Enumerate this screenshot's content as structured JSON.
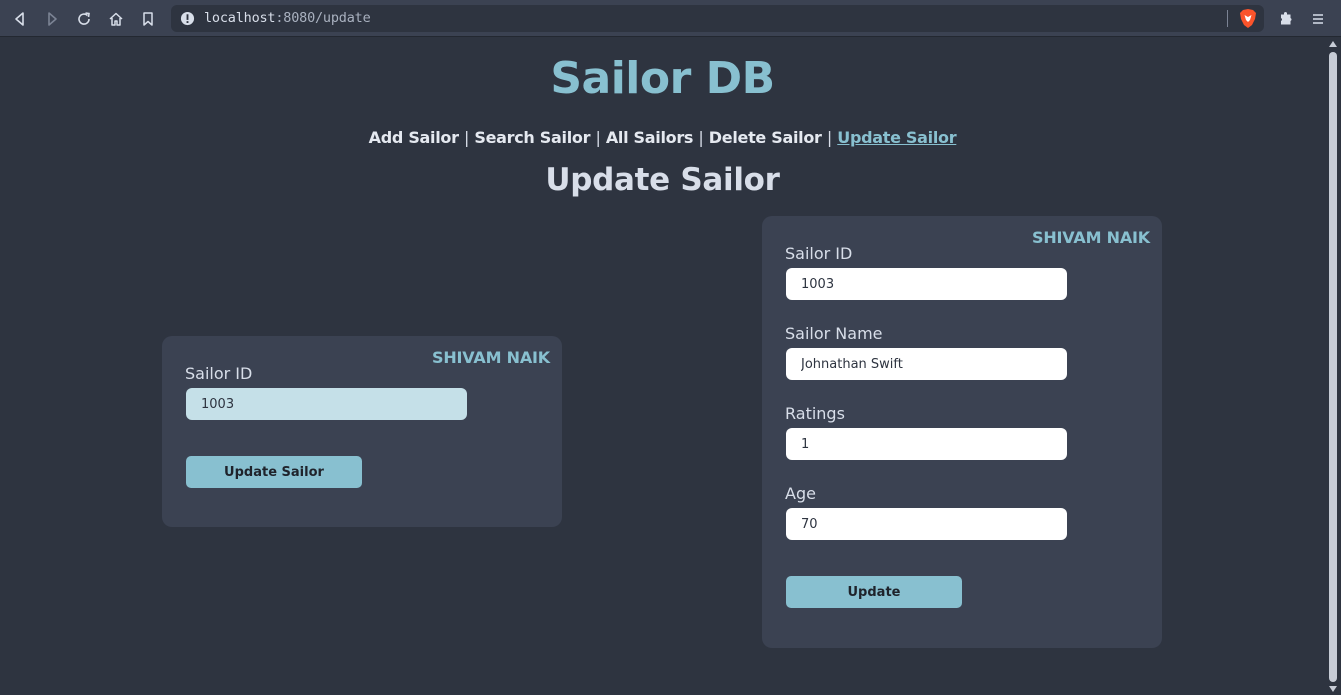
{
  "browser": {
    "url_host": "localhost",
    "url_rest": ":8080/update"
  },
  "site": {
    "title": "Sailor DB",
    "nav": [
      {
        "label": "Add Sailor"
      },
      {
        "label": "Search Sailor"
      },
      {
        "label": "All Sailors"
      },
      {
        "label": "Delete Sailor"
      },
      {
        "label": "Update Sailor",
        "active": true
      }
    ],
    "separator": "|"
  },
  "page": {
    "heading": "Update Sailor"
  },
  "lookup_form": {
    "owner": "SHIVAM NAIK",
    "sailor_id_label": "Sailor ID",
    "sailor_id_value": "1003",
    "submit_label": "Update Sailor"
  },
  "update_form": {
    "owner": "SHIVAM NAIK",
    "sailor_id_label": "Sailor ID",
    "sailor_id_value": "1003",
    "sailor_name_label": "Sailor Name",
    "sailor_name_value": "Johnathan Swift",
    "ratings_label": "Ratings",
    "ratings_value": "1",
    "age_label": "Age",
    "age_value": "70",
    "submit_label": "Update"
  },
  "colors": {
    "background": "#2e3440",
    "card": "#3b4252",
    "accent": "#88c0d0"
  }
}
